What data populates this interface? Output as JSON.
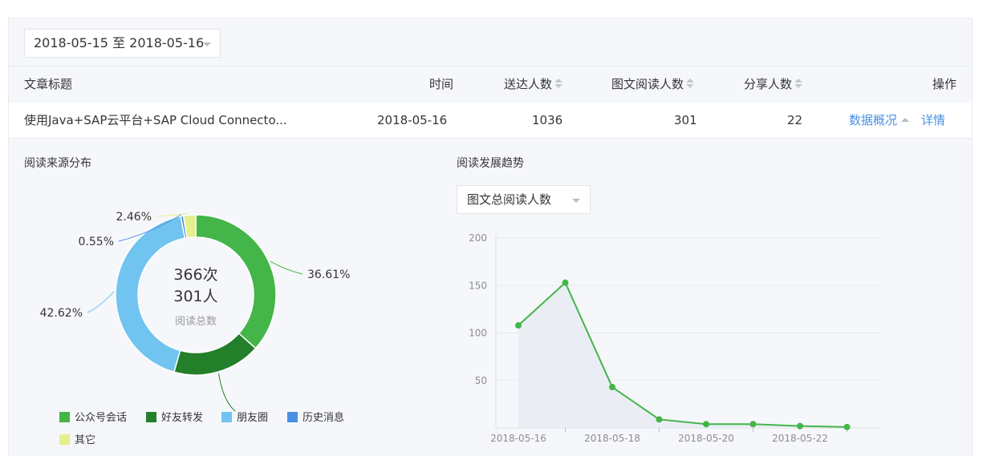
{
  "date_range": {
    "label": "2018-05-15 至 2018-05-16"
  },
  "table": {
    "headers": {
      "title": "文章标题",
      "time": "时间",
      "delivered": "送达人数",
      "readers": "图文阅读人数",
      "shares": "分享人数",
      "actions": "操作"
    },
    "row": {
      "title": "使用Java+SAP云平台+SAP Cloud Connecto...",
      "time": "2018-05-16",
      "delivered": "1036",
      "readers": "301",
      "shares": "22",
      "overview_link": "数据概况",
      "detail_link": "详情"
    }
  },
  "read_source": {
    "title": "阅读来源分布",
    "center_count": "366次",
    "center_people": "301人",
    "center_caption": "阅读总数"
  },
  "read_trend": {
    "title": "阅读发展趋势",
    "metric_select": "图文总阅读人数"
  },
  "chart_data": [
    {
      "type": "pie",
      "labels": [
        "公众号会话",
        "好友转发",
        "朋友圈",
        "历史消息",
        "其它"
      ],
      "values": [
        36.61,
        17.76,
        42.62,
        0.55,
        2.46
      ],
      "value_labels": [
        "36.61%",
        "17.76%",
        "42.62%",
        "0.55%",
        "2.46%"
      ],
      "colors": [
        "#44b549",
        "#237f2a",
        "#71c4f0",
        "#4a90e2",
        "#e6ef8e"
      ],
      "legend": "bottom-left",
      "center_text": [
        "366次",
        "301人",
        "阅读总数"
      ]
    },
    {
      "type": "line",
      "x": [
        "2018-05-16",
        "2018-05-17",
        "2018-05-18",
        "2018-05-19",
        "2018-05-20",
        "2018-05-21",
        "2018-05-22",
        "2018-05-23"
      ],
      "x_tick_labels": [
        "2018-05-16",
        "2018-05-18",
        "2018-05-20",
        "2018-05-22"
      ],
      "series": [
        {
          "values": [
            108,
            153,
            43,
            9,
            4,
            4,
            2,
            1
          ]
        }
      ],
      "y_ticks": [
        "200",
        "150",
        "100",
        "50"
      ],
      "ylim": [
        0,
        200
      ],
      "grid": true,
      "area_fill": true,
      "colors": {
        "line": "#44b549",
        "area": "#eaeef4"
      }
    }
  ]
}
